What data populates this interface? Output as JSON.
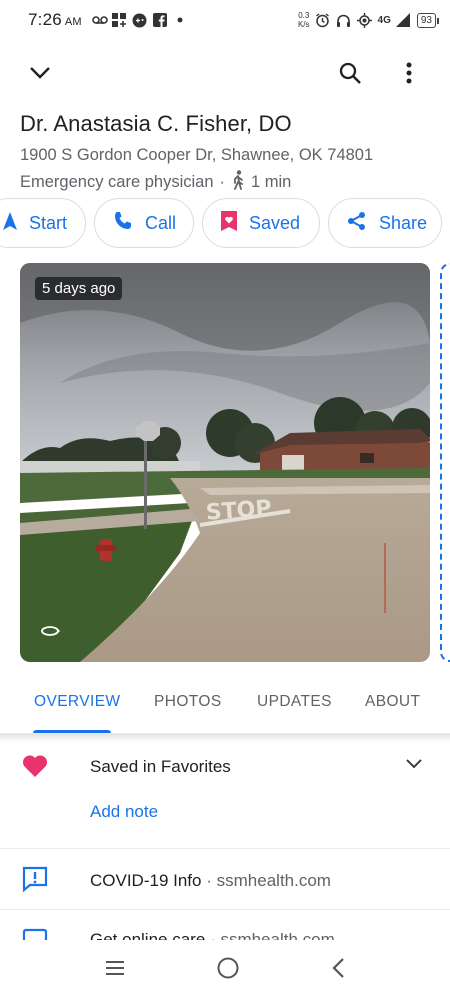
{
  "status_bar": {
    "time": "7:26",
    "ampm": "AM",
    "net_speed_value": "0.3",
    "net_speed_unit": "K/s",
    "network": "4G",
    "battery": "93"
  },
  "place": {
    "name": "Dr. Anastasia C. Fisher, DO",
    "address": "1900 S Gordon Cooper Dr, Shawnee, OK 74801",
    "category": "Emergency care physician",
    "separator": "·",
    "walk_time": "1 min"
  },
  "actions": {
    "start": "Start",
    "call": "Call",
    "saved": "Saved",
    "share": "Share"
  },
  "photo": {
    "age_badge": "5 days ago",
    "street_sign_text": "STOP"
  },
  "tabs": [
    "OVERVIEW",
    "PHOTOS",
    "UPDATES",
    "ABOUT"
  ],
  "saved_section": {
    "label": "Saved in Favorites",
    "add_note": "Add note"
  },
  "covid": {
    "label": "COVID-19 Info",
    "separator": "·",
    "source": "ssmhealth.com"
  },
  "online_care": {
    "label": "Get online care",
    "separator": "·",
    "source": "ssmhealth.com"
  },
  "colors": {
    "accent": "#1a73e8",
    "saved_pink": "#e8336d",
    "text": "#202124",
    "muted": "#5f6368"
  }
}
